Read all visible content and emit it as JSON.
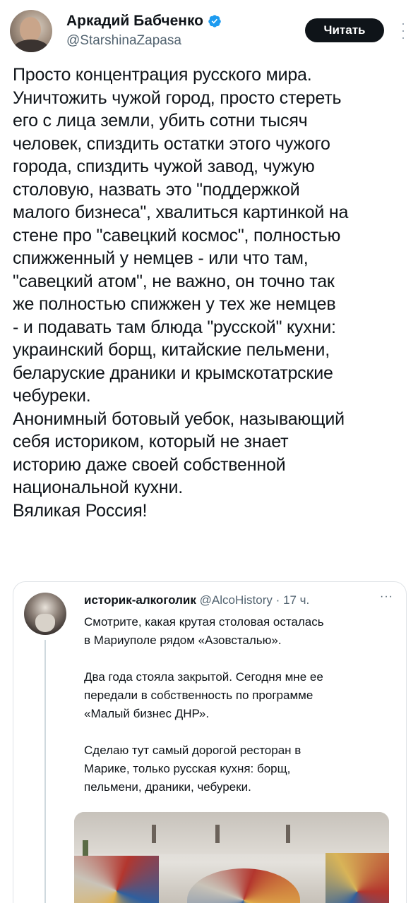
{
  "author": {
    "name": "Аркадий Бабченко",
    "handle": "@StarshinaZapasa",
    "verified": true
  },
  "follow_button": {
    "label": "Читать"
  },
  "colors": {
    "verified_badge": "#1d9bf0",
    "follow_button_bg": "#0f1419",
    "secondary_text": "#536471"
  },
  "icons": [
    "avatar",
    "verified-badge-icon",
    "more-vertical-icon",
    "more-horizontal-icon"
  ],
  "tweet": {
    "text": "Просто концентрация русского мира.\nУничтожить чужой город, просто стереть\nего с лица земли, убить сотни тысяч\nчеловек, спиздить остатки этого чужого\nгорода, спиздить чужой завод, чужую\nстоловую, назвать это \"поддержкой\nмалого бизнеса\", хвалиться картинкой на\nстене про \"савецкий космос\", полностью\nспижженный у немцев - или что там,\n\"савецкий атом\", не важно, он точно так\nже полностью спижжен у тех же немцев\n- и подавать там блюда \"русской\" кухни:\nукраинский борщ, китайские пельмени,\nбеларуские драники и крымскотатрские\nчебуреки.\nАнонимный ботовый уебок, называющий\nсебя историком, который не знает\nисторию даже своей собственной\nнациональной кухни.\nВяликая Россия!"
  },
  "quote": {
    "name": "историк-алкоголик",
    "handle": "@AlcoHistory",
    "time": "· 17 ч.",
    "more": "···",
    "text": "Смотрите, какая крутая столовая осталась\nв Мариуполе рядом «Азовсталью».\n\nДва года стояла закрытой. Сегодня мне ее\nпередали в собственность по программе\n«Малый бизнес ДНР».\n\nСделаю тут самый дорогой ресторан в\nМарике, только русская кухня: борщ,\nпельмени, драники, чебуреки."
  }
}
